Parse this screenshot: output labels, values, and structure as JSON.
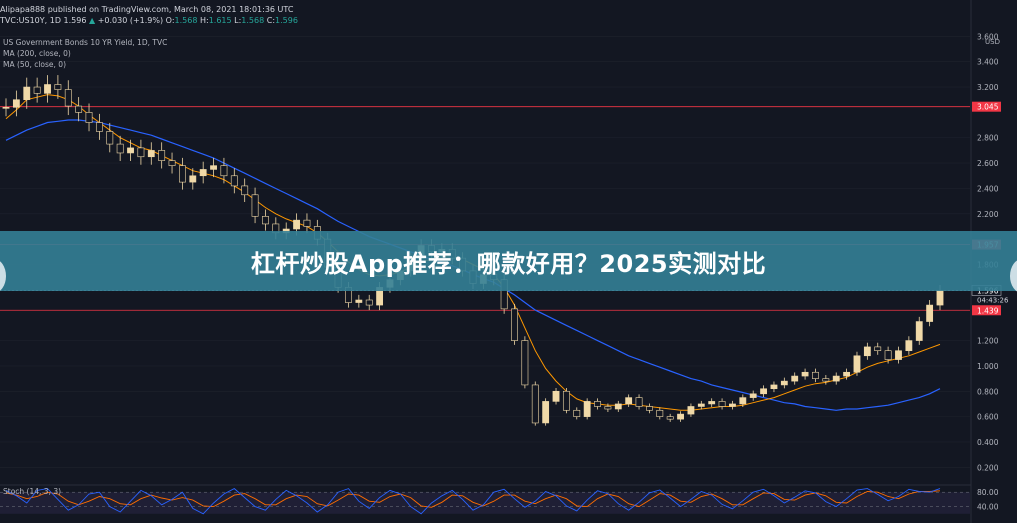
{
  "header": {
    "publish_line": "Alipapa888 published on TradingView.com, March 08, 2021 18:01:36 UTC",
    "symbol": "TVC:US10Y, 1D",
    "last": "1.596",
    "change_arrow": "▲",
    "change": "+0.030 (+1.9%)",
    "o_label": "O:",
    "o_value": "1.568",
    "h_label": "H:",
    "h_value": "1.615",
    "l_label": "L:",
    "l_value": "1.568",
    "c_label": "C:",
    "c_value": "1.596"
  },
  "legend": {
    "title": "US Government Bonds 10 YR Yield, 1D, TVC",
    "ma200": "MA (200, close, 0)",
    "ma50": "MA (50, close, 0)"
  },
  "banner": {
    "title": "杠杆炒股App推荐：哪款好用？2025实测对比"
  },
  "stoch": {
    "label": "Stoch (14, 3, 3)",
    "ticks": [
      "80.00",
      "40.00"
    ],
    "colors": {
      "k": "#2962ff",
      "d": "#ff6d00",
      "band": "#7e57c2"
    }
  },
  "colors": {
    "background": "#131722",
    "up": "#26a69a",
    "candle": "#f0d9a8",
    "ma50": "#ff9800",
    "ma200": "#2962ff",
    "price_line": "#f23645",
    "banner": "#348096"
  },
  "chart_data": {
    "type": "candlestick",
    "title": "US Government Bonds 10 YR Yield, 1D, TVC",
    "y_unit": "USD",
    "ylim": [
      0.1,
      3.65
    ],
    "y_ticks": [
      "3.600",
      "3.400",
      "3.200",
      "3.045",
      "2.800",
      "2.600",
      "2.400",
      "2.200",
      "1.957",
      "1.800",
      "1.596",
      "04:43:26",
      "1.439",
      "1.200",
      "1.000",
      "0.800",
      "0.600",
      "0.400",
      "0.200"
    ],
    "price_markers": [
      {
        "value": 3.045,
        "label": "3.045",
        "color": "#f23645"
      },
      {
        "value": 1.957,
        "label": "1.957",
        "color": "#f23645"
      },
      {
        "value": 1.596,
        "label": "1.596",
        "color": "#131722",
        "sub": "04:43:26"
      },
      {
        "value": 1.439,
        "label": "1.439",
        "color": "#f23645"
      }
    ],
    "close_series": [
      3.04,
      3.1,
      3.2,
      3.15,
      3.22,
      3.18,
      3.05,
      3.0,
      2.92,
      2.85,
      2.75,
      2.68,
      2.72,
      2.65,
      2.7,
      2.62,
      2.58,
      2.45,
      2.5,
      2.55,
      2.58,
      2.5,
      2.42,
      2.35,
      2.18,
      2.12,
      2.05,
      2.08,
      2.15,
      2.1,
      2.0,
      1.78,
      1.62,
      1.5,
      1.52,
      1.48,
      1.62,
      1.68,
      1.75,
      1.85,
      1.95,
      1.9,
      1.92,
      1.85,
      1.75,
      1.65,
      1.72,
      1.68,
      1.45,
      1.2,
      0.85,
      0.55,
      0.72,
      0.8,
      0.65,
      0.6,
      0.72,
      0.68,
      0.66,
      0.7,
      0.75,
      0.68,
      0.65,
      0.6,
      0.58,
      0.62,
      0.68,
      0.7,
      0.72,
      0.68,
      0.7,
      0.75,
      0.78,
      0.82,
      0.85,
      0.88,
      0.92,
      0.95,
      0.9,
      0.88,
      0.92,
      0.95,
      1.08,
      1.15,
      1.12,
      1.05,
      1.12,
      1.2,
      1.35,
      1.48,
      1.596
    ],
    "ma50_series": [
      2.95,
      3.02,
      3.1,
      3.12,
      3.14,
      3.13,
      3.1,
      3.05,
      2.98,
      2.92,
      2.86,
      2.8,
      2.76,
      2.72,
      2.7,
      2.66,
      2.62,
      2.58,
      2.54,
      2.52,
      2.5,
      2.47,
      2.42,
      2.37,
      2.31,
      2.25,
      2.2,
      2.16,
      2.13,
      2.1,
      2.05,
      1.98,
      1.9,
      1.82,
      1.76,
      1.72,
      1.71,
      1.72,
      1.74,
      1.78,
      1.82,
      1.84,
      1.86,
      1.86,
      1.84,
      1.8,
      1.76,
      1.72,
      1.62,
      1.48,
      1.3,
      1.12,
      0.98,
      0.88,
      0.8,
      0.74,
      0.71,
      0.7,
      0.69,
      0.69,
      0.7,
      0.69,
      0.68,
      0.67,
      0.66,
      0.65,
      0.65,
      0.66,
      0.67,
      0.68,
      0.68,
      0.69,
      0.71,
      0.73,
      0.75,
      0.78,
      0.81,
      0.84,
      0.86,
      0.87,
      0.89,
      0.91,
      0.95,
      0.99,
      1.02,
      1.04,
      1.06,
      1.08,
      1.11,
      1.14,
      1.17
    ],
    "ma200_series": [
      2.78,
      2.82,
      2.86,
      2.89,
      2.92,
      2.93,
      2.94,
      2.94,
      2.93,
      2.92,
      2.9,
      2.88,
      2.86,
      2.84,
      2.82,
      2.79,
      2.76,
      2.73,
      2.7,
      2.67,
      2.64,
      2.6,
      2.56,
      2.52,
      2.48,
      2.44,
      2.4,
      2.36,
      2.32,
      2.28,
      2.24,
      2.19,
      2.14,
      2.1,
      2.06,
      2.02,
      1.99,
      1.96,
      1.93,
      1.9,
      1.87,
      1.84,
      1.82,
      1.79,
      1.76,
      1.72,
      1.69,
      1.66,
      1.61,
      1.56,
      1.5,
      1.44,
      1.4,
      1.36,
      1.32,
      1.28,
      1.24,
      1.2,
      1.16,
      1.12,
      1.08,
      1.05,
      1.02,
      0.99,
      0.96,
      0.93,
      0.9,
      0.88,
      0.85,
      0.83,
      0.81,
      0.79,
      0.77,
      0.75,
      0.73,
      0.71,
      0.7,
      0.68,
      0.67,
      0.66,
      0.65,
      0.66,
      0.66,
      0.67,
      0.68,
      0.69,
      0.71,
      0.73,
      0.75,
      0.78,
      0.82
    ],
    "stoch_ylim": [
      0,
      100
    ],
    "stoch_k": [
      85,
      70,
      50,
      85,
      90,
      60,
      30,
      45,
      75,
      80,
      40,
      25,
      55,
      85,
      70,
      45,
      60,
      80,
      35,
      20,
      50,
      75,
      90,
      65,
      40,
      30,
      60,
      85,
      70,
      50,
      25,
      45,
      80,
      90,
      55,
      35,
      65,
      85,
      75,
      40,
      20,
      50,
      70,
      85,
      60,
      30,
      45,
      80,
      88,
      62,
      38,
      55,
      82,
      70,
      42,
      28,
      58,
      84,
      76,
      48,
      30,
      52,
      78,
      86,
      64,
      40,
      60,
      82,
      72,
      46,
      34,
      56,
      80,
      88,
      70,
      50,
      66,
      84,
      78,
      54,
      40,
      62,
      86,
      90,
      74,
      56,
      68,
      88,
      82,
      80,
      90
    ],
    "stoch_d": [
      78,
      72,
      62,
      68,
      80,
      75,
      55,
      45,
      55,
      68,
      62,
      48,
      45,
      62,
      72,
      64,
      58,
      65,
      58,
      42,
      40,
      55,
      72,
      76,
      62,
      45,
      45,
      62,
      72,
      68,
      48,
      42,
      58,
      75,
      72,
      55,
      52,
      68,
      75,
      65,
      42,
      38,
      52,
      72,
      70,
      52,
      42,
      55,
      72,
      72,
      55,
      48,
      62,
      72,
      62,
      42,
      40,
      62,
      75,
      68,
      48,
      40,
      58,
      76,
      72,
      55,
      52,
      68,
      75,
      62,
      45,
      45,
      62,
      78,
      76,
      60,
      58,
      72,
      78,
      70,
      52,
      50,
      68,
      82,
      80,
      68,
      62,
      75,
      82,
      82,
      84
    ]
  }
}
